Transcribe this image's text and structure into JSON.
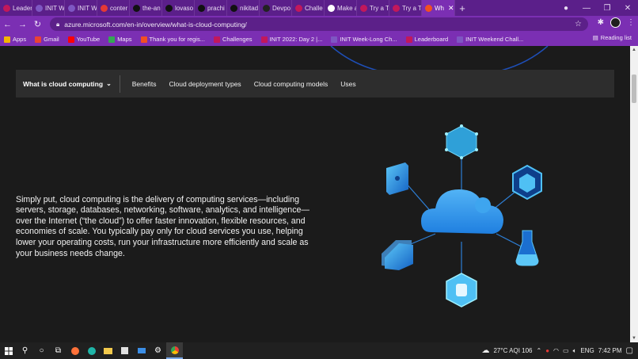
{
  "browser": {
    "tabs": [
      {
        "label": "Leader",
        "color": "#c2185b"
      },
      {
        "label": "INIT W",
        "color": "#7e57c2"
      },
      {
        "label": "INIT W",
        "color": "#7e57c2"
      },
      {
        "label": "conter",
        "color": "#e53935"
      },
      {
        "label": "the-an",
        "color": "#111111"
      },
      {
        "label": "lovaso",
        "color": "#111111"
      },
      {
        "label": "prachi",
        "color": "#111111"
      },
      {
        "label": "nikitad",
        "color": "#111111"
      },
      {
        "label": "Devpo",
        "color": "#222222"
      },
      {
        "label": "Challe",
        "color": "#c2185b"
      },
      {
        "label": "Make a",
        "color": "#ffffff"
      },
      {
        "label": "Try a Te",
        "color": "#c2185b"
      },
      {
        "label": "Try a Te",
        "color": "#c2185b"
      },
      {
        "label": "Wh",
        "color": "#f25022",
        "active": true
      }
    ],
    "new_tab": "+",
    "url": "azure.microsoft.com/en-in/overview/what-is-cloud-computing/"
  },
  "bookmarks": [
    {
      "label": "Apps",
      "color": "#f4b400"
    },
    {
      "label": "Gmail",
      "color": "#ea4335"
    },
    {
      "label": "YouTube",
      "color": "#ff0000"
    },
    {
      "label": "Maps",
      "color": "#34a853"
    },
    {
      "label": "Thank you for regis...",
      "color": "#f25022"
    },
    {
      "label": "Challenges",
      "color": "#c2185b"
    },
    {
      "label": "INIT 2022: Day 2 |...",
      "color": "#c2185b"
    },
    {
      "label": "INIT Week-Long Ch...",
      "color": "#7e57c2"
    },
    {
      "label": "Leaderboard",
      "color": "#c2185b"
    },
    {
      "label": "INIT Weekend Chall...",
      "color": "#7e57c2"
    }
  ],
  "reading_list": "Reading list",
  "subnav": {
    "current": "What is cloud computing",
    "links": [
      "Benefits",
      "Cloud deployment types",
      "Cloud computing models",
      "Uses"
    ]
  },
  "lead": "Simply put, cloud computing is the delivery of computing services—including servers, storage, databases, networking, software, analytics, and intelligence—over the Internet (“the cloud”) to offer faster innovation, flexible resources, and economies of scale. You typically pay only for cloud services you use, helping lower your operating costs, run your infrastructure more efficiently and scale as your business needs change.",
  "taskbar": {
    "weather": "27°C AQI 106",
    "language": "ENG",
    "time": "7:42 PM"
  },
  "colors": {
    "tab_strip": "#5b1f8a",
    "toolbar": "#7b2fb3",
    "page_bg": "#1b1b1b",
    "subnav_bg": "#2d2d2d",
    "cloud": "#2f8ee8"
  }
}
